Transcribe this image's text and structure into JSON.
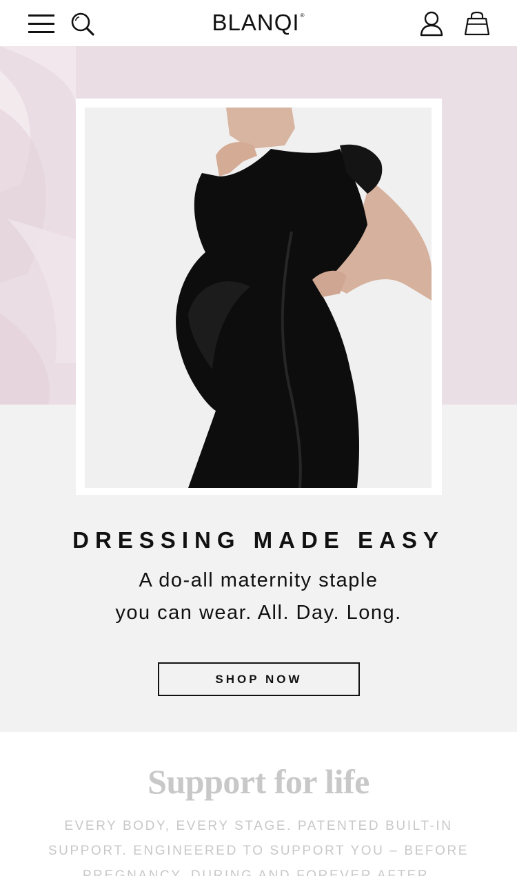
{
  "header": {
    "logo": "BLANQI",
    "logo_mark": "®",
    "icons": {
      "menu": "hamburger-menu-icon",
      "search": "search-icon",
      "account": "user-account-icon",
      "cart": "shopping-bag-icon"
    }
  },
  "hero": {
    "background_color": "#e9dce2",
    "image_alt": "Pregnant woman wearing a black short-sleeve maternity dress",
    "headline": "DRESSING MADE EASY",
    "subline_1": "A do-all maternity staple",
    "subline_2": "you can wear. All. Day. Long.",
    "cta_label": "SHOP NOW"
  },
  "support": {
    "title": "Support for life",
    "body": "EVERY BODY, EVERY STAGE. PATENTED BUILT-IN SUPPORT. ENGINEERED TO SUPPORT YOU – BEFORE PREGNANCY, DURING AND FOREVER AFTER."
  }
}
